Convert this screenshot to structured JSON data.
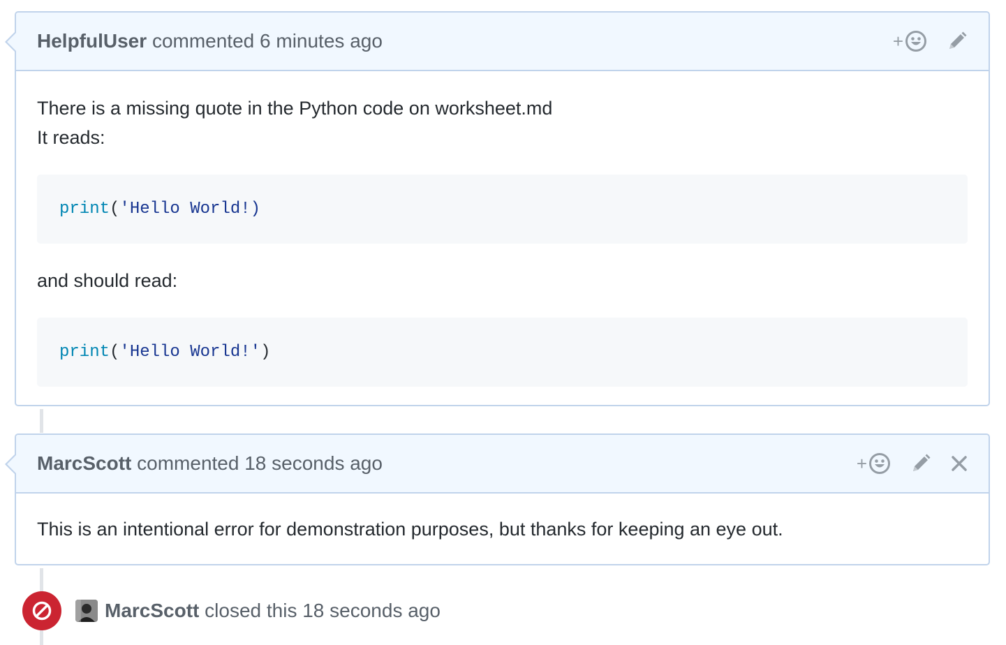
{
  "comments": [
    {
      "author": "HelpfulUser",
      "action": "commented",
      "time": "6 minutes ago",
      "body_line1": "There is a missing quote in the Python code on worksheet.md",
      "body_line2": "It reads:",
      "code1": {
        "fn": "print",
        "open": "(",
        "str": "'Hello World!",
        "close": ")"
      },
      "body_line3": "and should read:",
      "code2": {
        "fn": "print",
        "open": "(",
        "str": "'Hello World!'",
        "close": ")"
      }
    },
    {
      "author": "MarcScott",
      "action": "commented",
      "time": "18 seconds ago",
      "body": "This is an intentional error for demonstration purposes, but thanks for keeping an eye out."
    }
  ],
  "event": {
    "actor": "MarcScott",
    "action": "closed this",
    "time": "18 seconds ago"
  },
  "reaction_plus": "+",
  "icons": [
    "add-reaction-icon",
    "pencil-icon",
    "close-icon",
    "closed-issue-icon"
  ],
  "colors": {
    "header_bg": "#f1f8ff",
    "border": "#c0d3eb",
    "closed_red": "#cb2431",
    "code_fn": "#0086b3",
    "code_str": "#183691"
  }
}
